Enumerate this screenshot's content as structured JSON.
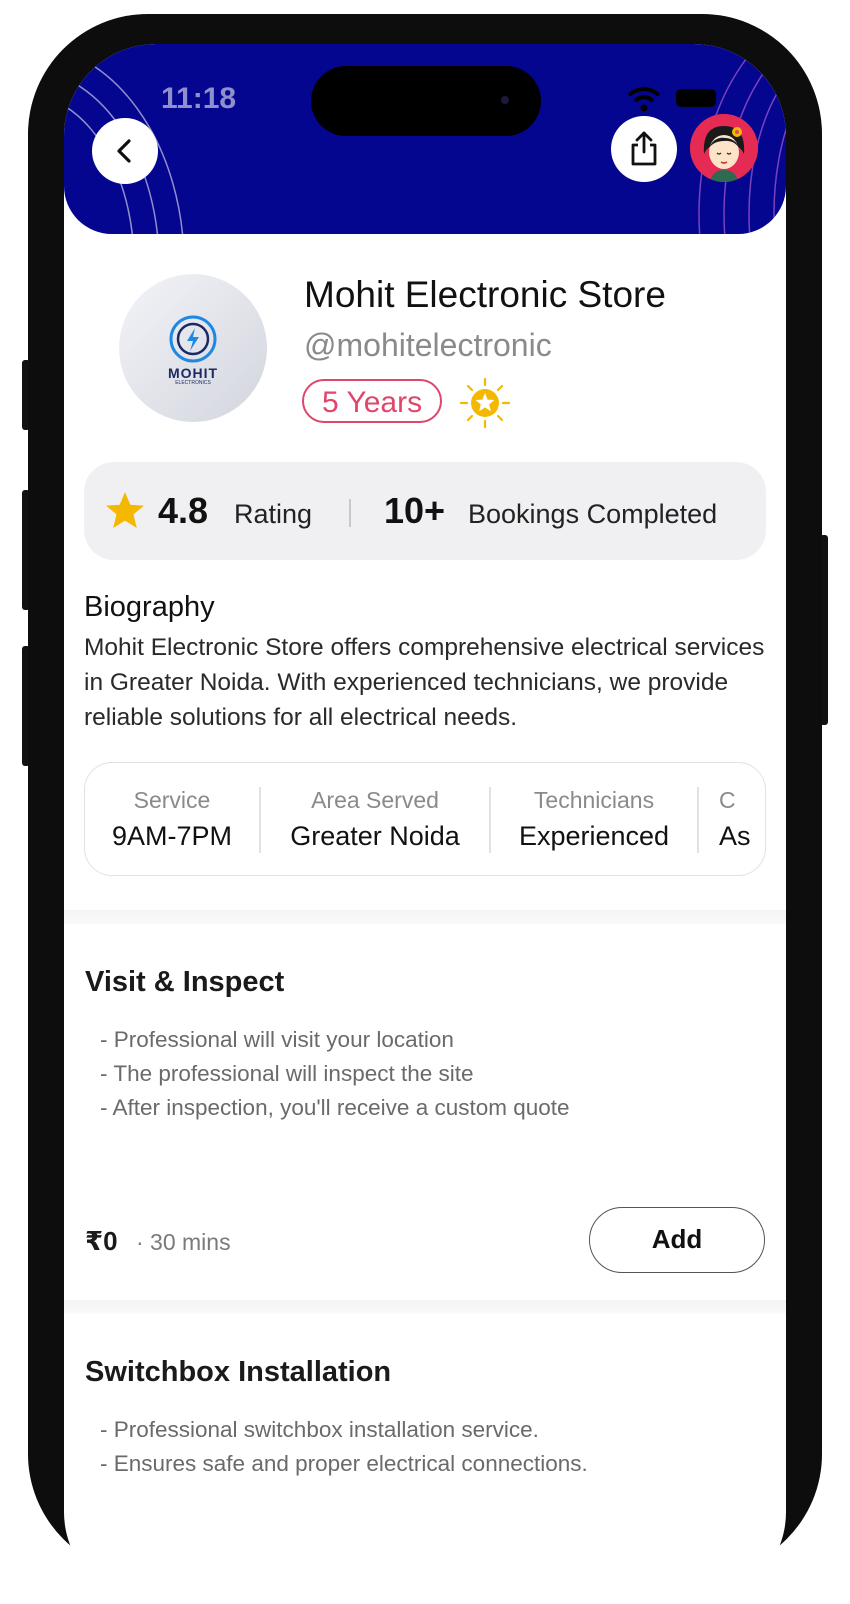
{
  "status_bar": {
    "time": "11:18"
  },
  "profile": {
    "logo_text": "MOHIT",
    "logo_subtext": "ELECTRONICS",
    "store_name": "Mohit Electronic Store",
    "handle": "@mohitelectronic",
    "experience_badge": "5 Years"
  },
  "stats": {
    "rating_value": "4.8",
    "rating_label": "Rating",
    "bookings_value": "10+",
    "bookings_label": "Bookings Completed"
  },
  "biography": {
    "title": "Biography",
    "text": "Mohit Electronic Store offers comprehensive electrical services in Greater Noida. With experienced technicians, we provide reliable solutions for all electrical needs."
  },
  "info": [
    {
      "label": "Service",
      "value": "9AM-7PM"
    },
    {
      "label": "Area Served",
      "value": "Greater Noida"
    },
    {
      "label": "Technicians",
      "value": "Experienced"
    },
    {
      "label": "C",
      "value": "As"
    }
  ],
  "services": [
    {
      "title": "Visit & Inspect",
      "points": [
        "- Professional will visit your location",
        "- The professional will inspect the site",
        "- After inspection, you'll receive a custom quote"
      ],
      "price": "₹0",
      "duration": "· 30 mins",
      "add_label": "Add"
    },
    {
      "title": "Switchbox Installation",
      "points": [
        "- Professional switchbox installation service.",
        "- Ensures safe and proper electrical connections."
      ]
    }
  ],
  "icons": {
    "back": "chevron-left-icon",
    "share": "share-icon",
    "avatar": "user-avatar",
    "experience": "sun-star-icon",
    "rating": "star-icon"
  },
  "colors": {
    "header_bg": "#05068f",
    "badge_accent": "#e0466b",
    "star": "#f5b800"
  }
}
